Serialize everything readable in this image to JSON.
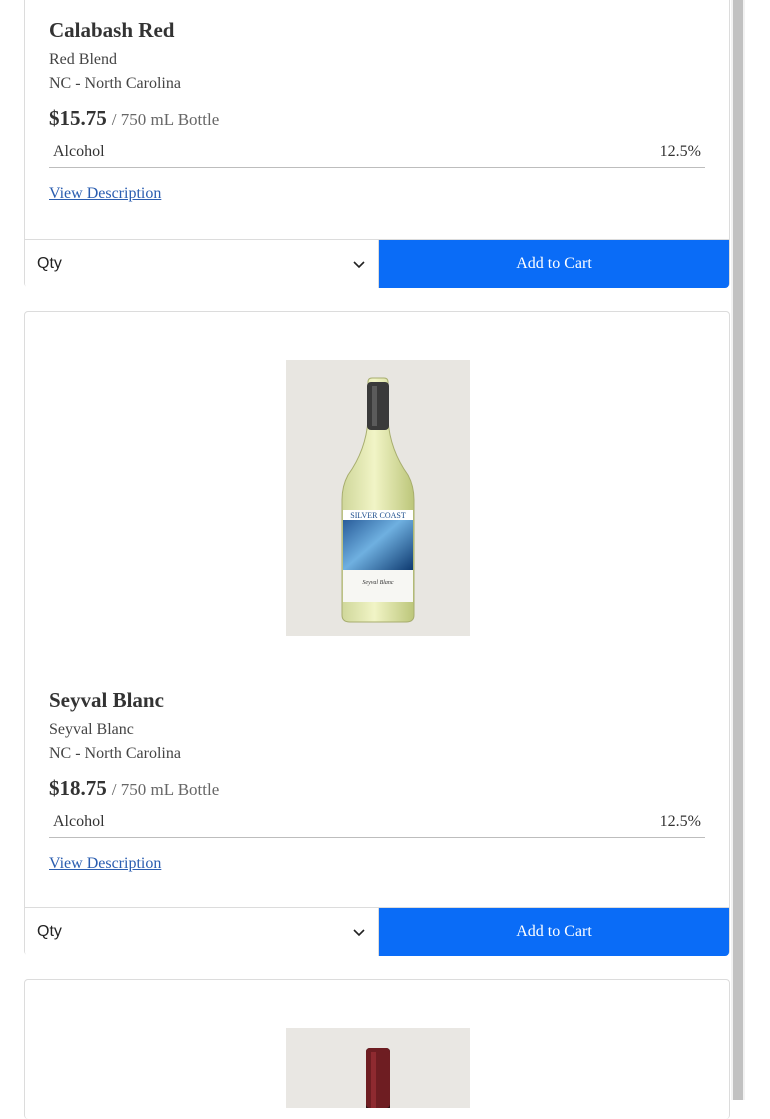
{
  "products": [
    {
      "name": "Calabash Red",
      "varietal": "Red Blend",
      "region": "NC - North Carolina",
      "price": "$15.75",
      "unit": "/ 750 mL Bottle",
      "attr_label": "Alcohol",
      "attr_value": "12.5%",
      "link": "View Description",
      "qty_label": "Qty",
      "cart_label": "Add to Cart"
    },
    {
      "name": "Seyval Blanc",
      "varietal": "Seyval Blanc",
      "region": "NC - North Carolina",
      "price": "$18.75",
      "unit": "/ 750 mL Bottle",
      "attr_label": "Alcohol",
      "attr_value": "12.5%",
      "link": "View Description",
      "qty_label": "Qty",
      "cart_label": "Add to Cart",
      "label_brand": "SILVER COAST",
      "label_wine": "Seyval Blanc"
    }
  ],
  "colors": {
    "accent": "#0a6cf7",
    "link": "#2a5db0",
    "border": "#dcdcdc"
  },
  "icons": {
    "qty": "chevron-down-icon"
  }
}
